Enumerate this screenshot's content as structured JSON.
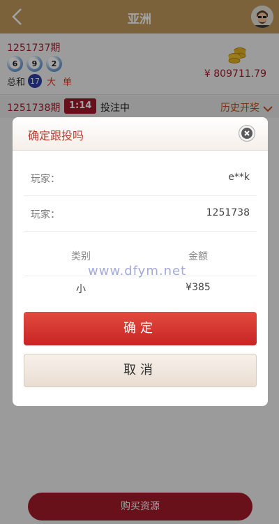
{
  "header": {
    "title": "亚洲"
  },
  "result": {
    "period": "1251737期",
    "balls": [
      "6",
      "9",
      "2"
    ],
    "sum_label": "总和",
    "sum_value": "17",
    "size": "大",
    "parity": "单",
    "balance": "¥ 809711.79"
  },
  "bar": {
    "current_period": "1251738期",
    "timer": "1:14",
    "status": "投注中",
    "history": "历史开奖"
  },
  "modal": {
    "title": "确定跟投吗",
    "rows": [
      {
        "label": "玩家：",
        "value": "e**k"
      },
      {
        "label": "玩家：",
        "value": "1251738"
      }
    ],
    "table": {
      "headers": [
        "类别",
        "金额"
      ],
      "row": [
        "小",
        "¥385"
      ]
    },
    "confirm": "确定",
    "cancel": "取消"
  },
  "watermark": "www.dfym.net",
  "bottom": {
    "buy_label": "购买资源"
  },
  "colors": {
    "header": "#c09a5c",
    "accent": "#a2192d",
    "confirm": "#d63a30"
  }
}
